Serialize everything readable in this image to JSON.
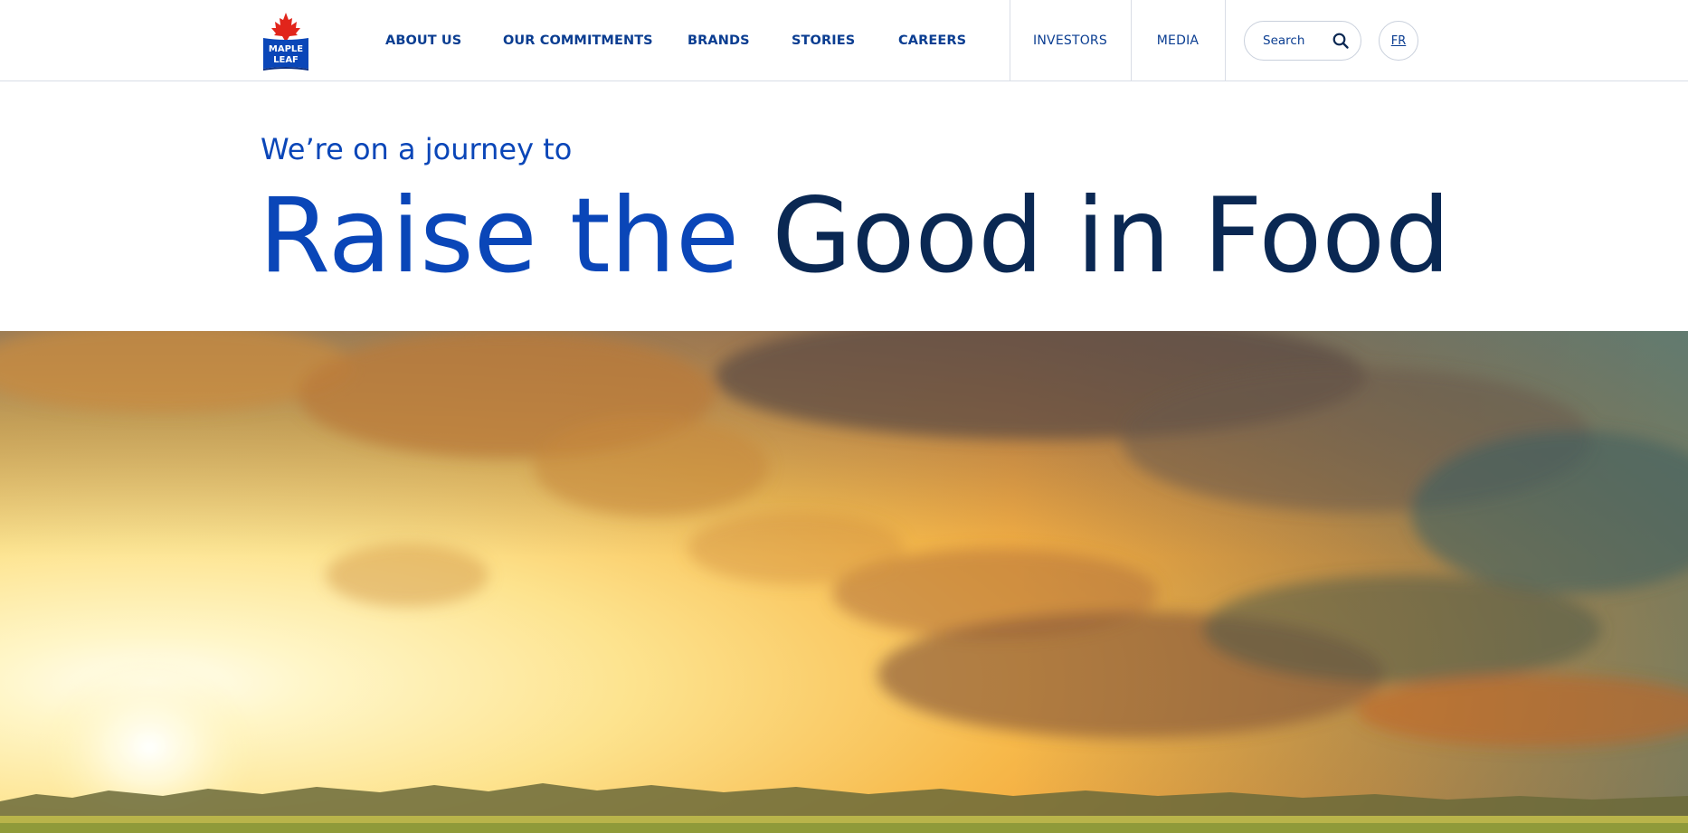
{
  "header": {
    "logo": {
      "line1": "MAPLE",
      "line2": "LEAF",
      "icon": "maple-leaf-logo"
    },
    "main_nav": [
      {
        "label": "ABOUT US"
      },
      {
        "label": "OUR COMMITMENTS"
      },
      {
        "label": "BRANDS"
      },
      {
        "label": "STORIES"
      },
      {
        "label": "CAREERS"
      }
    ],
    "secondary_nav": [
      {
        "label": "INVESTORS"
      },
      {
        "label": "MEDIA"
      }
    ],
    "search": {
      "placeholder": "Search",
      "value": "",
      "icon": "search-icon"
    },
    "language_toggle": "FR"
  },
  "hero": {
    "eyebrow": "We’re on a journey to",
    "headline_part1": "Raise the",
    "headline_part2": "Good in Food",
    "image": "sunset-over-field"
  },
  "colors": {
    "brand_blue": "#0a46b8",
    "navy": "#0a2853",
    "leaf_red": "#e1251b"
  }
}
